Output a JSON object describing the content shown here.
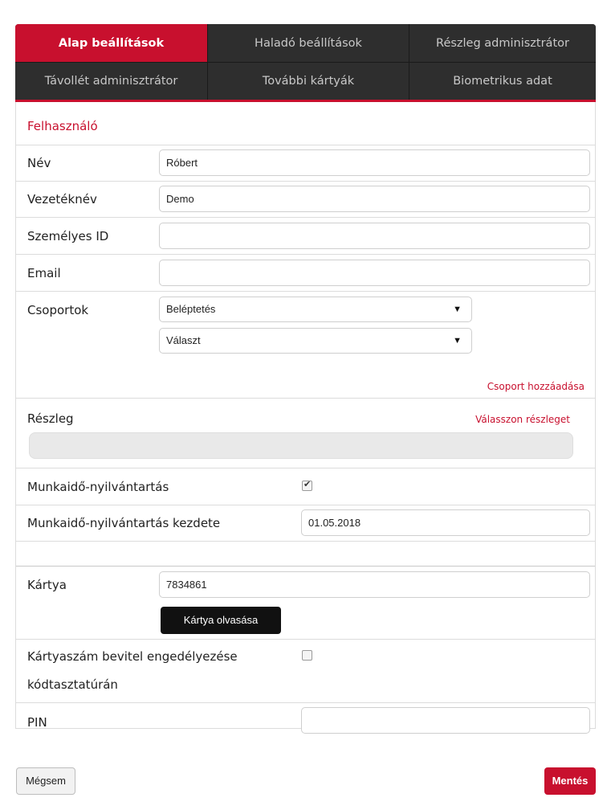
{
  "tabs": {
    "row1": [
      "Alap beállítások",
      "Haladó beállítások",
      "Részleg adminisztrátor"
    ],
    "row2": [
      "Távollét adminisztrátor",
      "További kártyák",
      "Biometrikus adat"
    ],
    "active": "Alap beállítások"
  },
  "section_title": "Felhasználó",
  "fields": {
    "name": {
      "label": "Név",
      "value": "Róbert"
    },
    "surname": {
      "label": "Vezetéknév",
      "value": "Demo"
    },
    "personal_id": {
      "label": "Személyes ID",
      "value": ""
    },
    "email": {
      "label": "Email",
      "value": ""
    }
  },
  "groups": {
    "label": "Csoportok",
    "selected": [
      "Beléptetés",
      "Választ"
    ],
    "add_link": "Csoport hozzáadása"
  },
  "department": {
    "label": "Részleg",
    "choose_link": "Válasszon részleget",
    "value": ""
  },
  "time_tracking": {
    "label": "Munkaidő-nyilvántartás",
    "checked": true,
    "start_label": "Munkaidő-nyilvántartás kezdete",
    "start_value": "01.05.2018"
  },
  "card": {
    "label": "Kártya",
    "value": "7834861",
    "read_button": "Kártya olvasása",
    "keyboard_label_line1": "Kártyaszám bevitel engedélyezése",
    "keyboard_label_line2": "kódtasztatúrán",
    "keyboard_checked": false
  },
  "pin": {
    "label": "PIN",
    "value": ""
  },
  "buttons": {
    "cancel": "Mégsem",
    "save": "Mentés"
  },
  "colors": {
    "accent": "#c8102e",
    "tab_bg": "#2e2e2e",
    "button_dark": "#111111"
  },
  "icons": {
    "select_arrow": "dropdown-arrow-icon",
    "checkbox": "checkbox-icon"
  }
}
